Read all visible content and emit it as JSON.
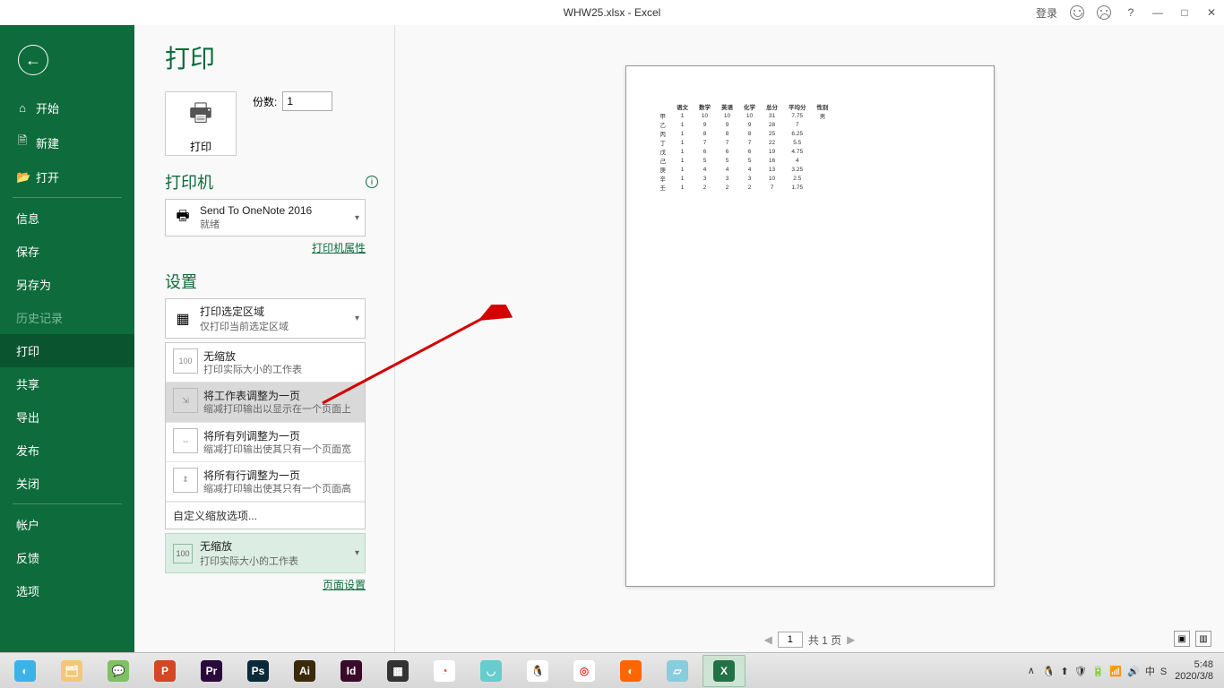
{
  "titlebar": {
    "filename": "WHW25.xlsx  -  Excel",
    "login": "登录",
    "help": "?",
    "minimize": "—",
    "maximize": "□",
    "close": "✕"
  },
  "sidebar": {
    "back_aria": "返回",
    "items": [
      {
        "icon": "⌂",
        "label": "开始"
      },
      {
        "icon": "🗎",
        "label": "新建"
      },
      {
        "icon": "📂",
        "label": "打开"
      }
    ],
    "items2": [
      {
        "label": "信息"
      },
      {
        "label": "保存"
      },
      {
        "label": "另存为"
      },
      {
        "label": "历史记录",
        "disabled": true
      },
      {
        "label": "打印",
        "active": true
      },
      {
        "label": "共享"
      },
      {
        "label": "导出"
      },
      {
        "label": "发布"
      },
      {
        "label": "关闭"
      }
    ],
    "items3": [
      {
        "label": "帐户"
      },
      {
        "label": "反馈"
      },
      {
        "label": "选项"
      }
    ]
  },
  "print": {
    "heading": "打印",
    "print_button": "打印",
    "copies_label": "份数:",
    "copies_value": "1",
    "printer_heading": "打印机",
    "printer_name": "Send To OneNote 2016",
    "printer_status": "就绪",
    "printer_props": "打印机属性",
    "settings_heading": "设置",
    "area": {
      "t1": "打印选定区域",
      "t2": "仅打印当前选定区域"
    },
    "scale_options": [
      {
        "t1": "无缩放",
        "t2": "打印实际大小的工作表",
        "ico": "100"
      },
      {
        "t1": "将工作表调整为一页",
        "t2": "缩减打印输出以显示在一个页面上",
        "ico": "⇲",
        "hover": true
      },
      {
        "t1": "将所有列调整为一页",
        "t2": "缩减打印输出使其只有一个页面宽",
        "ico": "⇔"
      },
      {
        "t1": "将所有行调整为一页",
        "t2": "缩减打印输出使其只有一个页面高",
        "ico": "⇕"
      }
    ],
    "custom_scale": "自定义缩放选项...",
    "current_scale": {
      "t1": "无缩放",
      "t2": "打印实际大小的工作表",
      "ico": "100"
    },
    "page_setup": "页面设置"
  },
  "pager": {
    "current": "1",
    "total_label": "共 1 页"
  },
  "chart_data": {
    "type": "table",
    "headers": [
      "",
      "语文",
      "数学",
      "英语",
      "化学",
      "总分",
      "平均分",
      "性别"
    ],
    "rows": [
      [
        "甲",
        "1",
        "10",
        "10",
        "10",
        "31",
        "7.75",
        "男"
      ],
      [
        "乙",
        "1",
        "9",
        "9",
        "9",
        "28",
        "7",
        ""
      ],
      [
        "丙",
        "1",
        "8",
        "8",
        "8",
        "25",
        "6.25",
        ""
      ],
      [
        "丁",
        "1",
        "7",
        "7",
        "7",
        "22",
        "5.5",
        ""
      ],
      [
        "戊",
        "1",
        "6",
        "6",
        "6",
        "19",
        "4.75",
        ""
      ],
      [
        "己",
        "1",
        "5",
        "5",
        "5",
        "16",
        "4",
        ""
      ],
      [
        "庚",
        "1",
        "4",
        "4",
        "4",
        "13",
        "3.25",
        ""
      ],
      [
        "辛",
        "1",
        "3",
        "3",
        "3",
        "10",
        "2.5",
        ""
      ],
      [
        "壬",
        "1",
        "2",
        "2",
        "2",
        "7",
        "1.75",
        ""
      ]
    ]
  },
  "taskbar": {
    "apps": [
      {
        "name": "browser",
        "color": "#3bb3e8",
        "glyph": "◐"
      },
      {
        "name": "explorer",
        "color": "#f2c877",
        "glyph": "🗂"
      },
      {
        "name": "wechat",
        "color": "#7fc162",
        "glyph": "💬"
      },
      {
        "name": "ppt",
        "color": "#d24726",
        "glyph": "P"
      },
      {
        "name": "premiere",
        "color": "#2a0a3a",
        "glyph": "Pr"
      },
      {
        "name": "ps",
        "color": "#0a2a3a",
        "glyph": "Ps"
      },
      {
        "name": "ai",
        "color": "#3a2a0a",
        "glyph": "Ai"
      },
      {
        "name": "id",
        "color": "#3a0a2a",
        "glyph": "Id"
      },
      {
        "name": "video",
        "color": "#333",
        "glyph": "▦"
      },
      {
        "name": "chart",
        "color": "#fff",
        "glyph": "◔",
        "fg": "#d33"
      },
      {
        "name": "chat",
        "color": "#6cc",
        "glyph": "◡"
      },
      {
        "name": "qq",
        "color": "#fff",
        "glyph": "🐧",
        "fg": "#000"
      },
      {
        "name": "chrome",
        "color": "#fff",
        "glyph": "◎",
        "fg": "#e33"
      },
      {
        "name": "firefox",
        "color": "#f60",
        "glyph": "◐"
      },
      {
        "name": "notes",
        "color": "#8cd",
        "glyph": "▱"
      },
      {
        "name": "excel",
        "color": "#217346",
        "glyph": "X",
        "active": true
      }
    ],
    "tray_icons": [
      "🐧",
      "⬆",
      "🛡",
      "🔋",
      "📶",
      "🔊",
      "中",
      "S"
    ],
    "tray_up": "∧",
    "time": "5:48",
    "date": "2020/3/8"
  }
}
